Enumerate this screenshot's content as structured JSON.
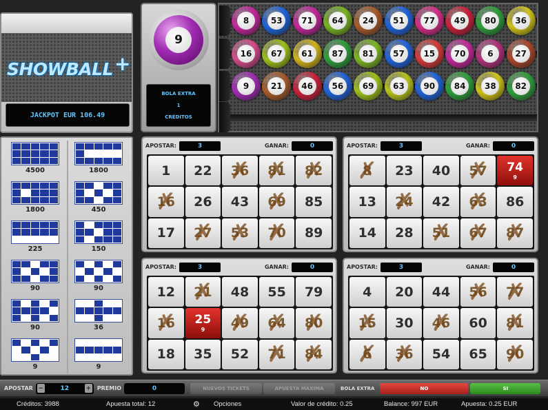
{
  "logo": {
    "title": "SHOWBALL",
    "plus": "+"
  },
  "jackpot": {
    "text": "JACKPOT EUR 106.49"
  },
  "drawn_ball": {
    "number": "9",
    "color": "#a02bb2"
  },
  "extra_ball_box": {
    "title": "BOLA EXTRA",
    "value": "1",
    "unit": "CRÉDITOS"
  },
  "drawn_balls": [
    {
      "n": "8",
      "color": "#c3279a"
    },
    {
      "n": "53",
      "color": "#1f62d6"
    },
    {
      "n": "71",
      "color": "#c3279a"
    },
    {
      "n": "64",
      "color": "#78b321"
    },
    {
      "n": "24",
      "color": "#a65a2a"
    },
    {
      "n": "51",
      "color": "#1f62d6"
    },
    {
      "n": "77",
      "color": "#d42e86"
    },
    {
      "n": "49",
      "color": "#c8203a"
    },
    {
      "n": "80",
      "color": "#2e9c3a"
    },
    {
      "n": "36",
      "color": "#cfc21a"
    },
    {
      "n": "16",
      "color": "#d44a8a"
    },
    {
      "n": "67",
      "color": "#9cbf1a"
    },
    {
      "n": "61",
      "color": "#d0b21a"
    },
    {
      "n": "87",
      "color": "#2e9c3a"
    },
    {
      "n": "81",
      "color": "#7cb423"
    },
    {
      "n": "57",
      "color": "#1f62d6"
    },
    {
      "n": "15",
      "color": "#d43a3a"
    },
    {
      "n": "70",
      "color": "#c3279a"
    },
    {
      "n": "6",
      "color": "#b0307a"
    },
    {
      "n": "27",
      "color": "#a8452a"
    },
    {
      "n": "9",
      "color": "#a02bb2"
    },
    {
      "n": "21",
      "color": "#a65a2a"
    },
    {
      "n": "46",
      "color": "#c8203a"
    },
    {
      "n": "56",
      "color": "#1f62d6"
    },
    {
      "n": "69",
      "color": "#9cbf1a"
    },
    {
      "n": "63",
      "color": "#b8c21a"
    },
    {
      "n": "90",
      "color": "#1f62d6"
    },
    {
      "n": "84",
      "color": "#2e9c3a"
    },
    {
      "n": "38",
      "color": "#cfc21a"
    },
    {
      "n": "82",
      "color": "#2e9c3a"
    }
  ],
  "prizes": [
    {
      "value": "4500",
      "pattern": "111111111111111"
    },
    {
      "value": "1800",
      "pattern": "111111000011111"
    },
    {
      "value": "1800",
      "pattern": "111111011111111"
    },
    {
      "value": "450",
      "pattern": "110111010111011"
    },
    {
      "value": "225",
      "pattern": "111111111100000"
    },
    {
      "value": "150",
      "pattern": "101111101110111"
    },
    {
      "value": "90",
      "pattern": "110111010111011"
    },
    {
      "value": "90",
      "pattern": "101010101010101"
    },
    {
      "value": "90",
      "pattern": "101011111010101"
    },
    {
      "value": "36",
      "pattern": "001001111100100"
    },
    {
      "value": "9",
      "pattern": "101010101000100"
    },
    {
      "value": "9",
      "pattern": "000001111100000"
    }
  ],
  "cards": [
    {
      "apostar_label": "APOSTAR:",
      "apostar": "3",
      "ganar_label": "GANAR:",
      "ganar": "0",
      "cells": [
        {
          "n": "1"
        },
        {
          "n": "22"
        },
        {
          "n": "36",
          "x": true
        },
        {
          "n": "81",
          "x": true
        },
        {
          "n": "82",
          "x": true
        },
        {
          "n": "16",
          "x": true
        },
        {
          "n": "26"
        },
        {
          "n": "43"
        },
        {
          "n": "69",
          "x": true
        },
        {
          "n": "85"
        },
        {
          "n": "17"
        },
        {
          "n": "27",
          "x": true
        },
        {
          "n": "53",
          "x": true
        },
        {
          "n": "70",
          "x": true
        },
        {
          "n": "89"
        }
      ]
    },
    {
      "apostar_label": "APOSTAR:",
      "apostar": "3",
      "ganar_label": "GANAR:",
      "ganar": "0",
      "cells": [
        {
          "n": "8",
          "x": true
        },
        {
          "n": "23"
        },
        {
          "n": "40"
        },
        {
          "n": "57",
          "x": true
        },
        {
          "n": "74",
          "red": true,
          "sub": "9"
        },
        {
          "n": "13"
        },
        {
          "n": "24",
          "x": true
        },
        {
          "n": "42"
        },
        {
          "n": "63",
          "x": true
        },
        {
          "n": "86"
        },
        {
          "n": "14"
        },
        {
          "n": "28"
        },
        {
          "n": "51",
          "x": true
        },
        {
          "n": "67",
          "x": true
        },
        {
          "n": "87",
          "x": true
        }
      ]
    },
    {
      "apostar_label": "APOSTAR:",
      "apostar": "3",
      "ganar_label": "GANAR:",
      "ganar": "0",
      "cells": [
        {
          "n": "12"
        },
        {
          "n": "21",
          "x": true
        },
        {
          "n": "48"
        },
        {
          "n": "55"
        },
        {
          "n": "79"
        },
        {
          "n": "16",
          "x": true
        },
        {
          "n": "25",
          "red": true,
          "sub": "9"
        },
        {
          "n": "49",
          "x": true
        },
        {
          "n": "64",
          "x": true
        },
        {
          "n": "80",
          "x": true
        },
        {
          "n": "18"
        },
        {
          "n": "35"
        },
        {
          "n": "52"
        },
        {
          "n": "71",
          "x": true
        },
        {
          "n": "84",
          "x": true
        }
      ]
    },
    {
      "apostar_label": "APOSTAR:",
      "apostar": "3",
      "ganar_label": "GANAR:",
      "ganar": "0",
      "cells": [
        {
          "n": "4"
        },
        {
          "n": "20"
        },
        {
          "n": "44"
        },
        {
          "n": "56",
          "x": true
        },
        {
          "n": "77",
          "x": true
        },
        {
          "n": "15",
          "x": true
        },
        {
          "n": "30"
        },
        {
          "n": "46",
          "x": true
        },
        {
          "n": "60"
        },
        {
          "n": "81",
          "x": true
        },
        {
          "n": "6",
          "x": true
        },
        {
          "n": "36",
          "x": true
        },
        {
          "n": "54"
        },
        {
          "n": "65"
        },
        {
          "n": "90",
          "x": true
        }
      ]
    }
  ],
  "controls": {
    "apostar_label": "APOSTAR",
    "apostar_value": "12",
    "minus": "−",
    "plus": "+",
    "premio_label": "PREMIO",
    "premio_value": "0",
    "nuevos_tickets": "NUEVOS TICKETS",
    "apuesta_maxima": "APUESTA MÁXIMA",
    "bola_extra_label": "BOLA EXTRA",
    "no": "NO",
    "si": "SI"
  },
  "status": {
    "creditos": "Créditos: 3988",
    "apuesta_total": "Apuesta total: 12",
    "opciones": "Opciones",
    "valor_credito": "Valor de crédito: 0.25",
    "balance": "Balance: 997 EUR",
    "apuesta": "Apuesta: 0.25 EUR"
  }
}
